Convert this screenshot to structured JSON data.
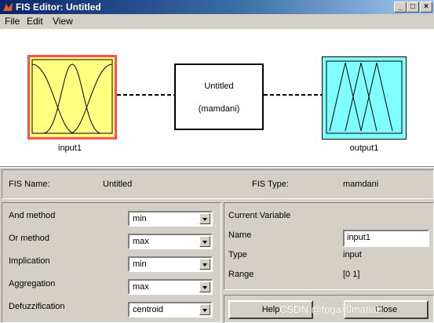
{
  "window": {
    "title": "FIS Editor: Untitled",
    "buttons": [
      "_",
      "□",
      "×"
    ]
  },
  "menu": [
    "File",
    "Edit",
    "View"
  ],
  "diagram": {
    "input_label": "input1",
    "output_label": "output1",
    "system_name": "Untitled",
    "system_type": "(mamdani)",
    "colors": {
      "input_fill": "#ffff80",
      "input_border": "#ff5050",
      "output_fill": "#80ffff"
    }
  },
  "info": {
    "fis_name_label": "FIS Name:",
    "fis_name_value": "Untitled",
    "fis_type_label": "FIS Type:",
    "fis_type_value": "mamdani"
  },
  "methods": [
    {
      "label": "And method",
      "value": "min"
    },
    {
      "label": "Or method",
      "value": "max"
    },
    {
      "label": "Implication",
      "value": "min"
    },
    {
      "label": "Aggregation",
      "value": "max"
    },
    {
      "label": "Defuzzification",
      "value": "centroid"
    }
  ],
  "current_variable": {
    "title": "Current Variable",
    "name_label": "Name",
    "name_value": "input1",
    "type_label": "Type",
    "type_value": "input",
    "range_label": "Range",
    "range_value": "[0 1]"
  },
  "buttons": {
    "help": "Help",
    "close": "Close"
  },
  "watermark": "CSDN @fpga和matlab"
}
